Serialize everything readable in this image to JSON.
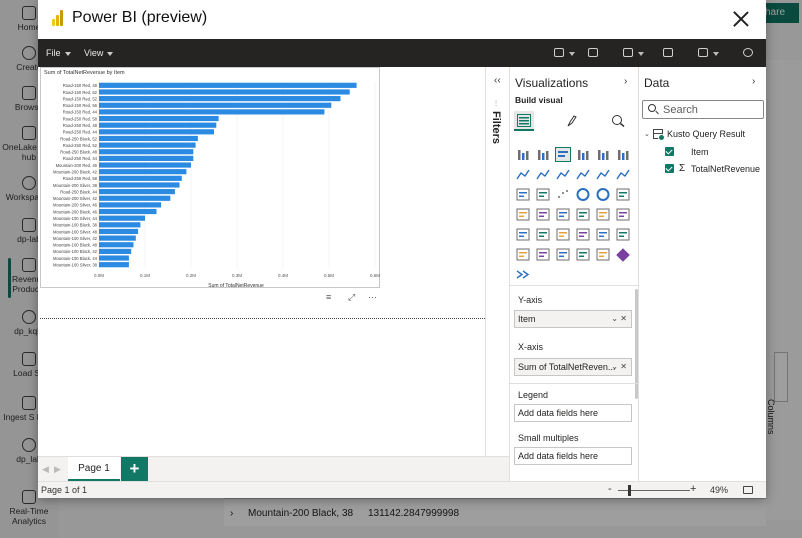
{
  "background": {
    "share_label": "hare",
    "nav_items": [
      {
        "label": "Home",
        "icon": "home-icon"
      },
      {
        "label": "Create",
        "icon": "create-icon"
      },
      {
        "label": "Browse",
        "icon": "browse-icon"
      },
      {
        "label": "OneLake data hub",
        "icon": "onelake-icon"
      },
      {
        "label": "Workspaces",
        "icon": "workspaces-icon"
      },
      {
        "label": "dp-lab",
        "icon": "workspace-icon"
      },
      {
        "label": "Revenue Products",
        "icon": "report-icon"
      },
      {
        "label": "dp_kql_",
        "icon": "kql-icon"
      },
      {
        "label": "Load Sa",
        "icon": "pipeline-icon"
      },
      {
        "label": "Ingest S Data",
        "icon": "ingest-icon"
      },
      {
        "label": "dp_lab",
        "icon": "lakehouse-icon"
      },
      {
        "label": "Real-Time Analytics",
        "icon": "realtime-icon"
      }
    ],
    "bottom_row": {
      "item": "Mountain-200 Black, 38",
      "value": "131142.2847999998"
    },
    "columns_label": "Columns"
  },
  "modal": {
    "title": "Power BI (preview)",
    "menu": {
      "file": "File",
      "view": "View"
    }
  },
  "chart_data": {
    "type": "bar",
    "orientation": "horizontal",
    "title": "Sum of TotalNetRevenue by Item",
    "xlabel": "Sum of TotalNetRevenue",
    "ylabel": "",
    "xlim": [
      0,
      600000
    ],
    "x_ticks": [
      "0.0M",
      "0.1M",
      "0.2M",
      "0.3M",
      "0.4M",
      "0.5M",
      "0.6M"
    ],
    "bar_color": "#2b8ae2",
    "grid": true,
    "categories": [
      "Road-150 Red, 48",
      "Road-150 Red, 62",
      "Road-150 Red, 52",
      "Road-150 Red, 56",
      "Road-150 Red, 44",
      "Road-250 Red, 58",
      "Road-250 Red, 48",
      "Road-250 Red, 44",
      "Road-250 Black, 52",
      "Road-250 Red, 52",
      "Road-250 Black, 48",
      "Road-250 Red, 44",
      "Mountain-200 Red, 46",
      "Mountain-200 Black, 42",
      "Road-250 Red, 58",
      "Mountain-200 Silver, 38",
      "Road-250 Black, 44",
      "Mountain-200 Silver, 42",
      "Mountain-200 Silver, 46",
      "Mountain-200 Black, 46",
      "Mountain-100 Silver, 44",
      "Mountain-100 Black, 38",
      "Mountain-100 Silver, 48",
      "Mountain-100 Silver, 42",
      "Mountain-100 Black, 48",
      "Mountain-100 Black, 42",
      "Mountain-100 Black, 44",
      "Mountain-100 Silver, 38"
    ],
    "values": [
      560000,
      545000,
      525000,
      505000,
      490000,
      260000,
      255000,
      250000,
      215000,
      210000,
      205000,
      205000,
      200000,
      190000,
      180000,
      175000,
      165000,
      155000,
      135000,
      125000,
      100000,
      90000,
      85000,
      80000,
      75000,
      70000,
      65000,
      65000
    ]
  },
  "canvas": {
    "visual_icons": [
      "filter-icon",
      "focus-mode-icon",
      "more-options-icon"
    ]
  },
  "pages": {
    "tabs": [
      "Page 1"
    ],
    "add_label": "+"
  },
  "status": {
    "page_info": "Page 1 of 1",
    "zoom": "49%",
    "zoom_minus": "-",
    "zoom_plus": "+"
  },
  "filters": {
    "label": "Filters"
  },
  "visualizations": {
    "title": "Visualizations",
    "build_visual": "Build visual",
    "y_axis_label": "Y-axis",
    "y_axis_field": "Item",
    "x_axis_label": "X-axis",
    "x_axis_field": "Sum of TotalNetReven...",
    "legend_label": "Legend",
    "legend_placeholder": "Add data fields here",
    "small_multiples_label": "Small multiples",
    "small_multiples_placeholder": "Add data fields here"
  },
  "data_pane": {
    "title": "Data",
    "search_placeholder": "Search",
    "table_name": "Kusto Query Result",
    "fields": [
      {
        "name": "Item",
        "checked": true,
        "sigma": false
      },
      {
        "name": "TotalNetRevenue",
        "checked": true,
        "sigma": true
      }
    ]
  },
  "colors": {
    "accent": "#117865",
    "bar": "#2b8ae2",
    "menubar": "#252423"
  }
}
